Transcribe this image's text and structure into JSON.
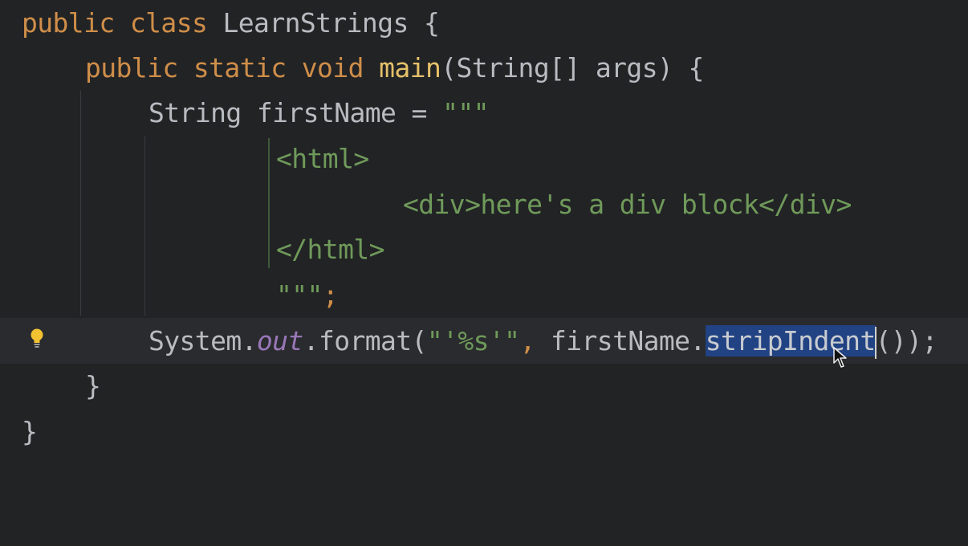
{
  "code": {
    "line1": {
      "kw1": "public",
      "kw2": "class",
      "name": "LearnStrings",
      "brace": "{"
    },
    "line2": {
      "kw1": "public",
      "kw2": "static",
      "kw3": "void",
      "fn": "main",
      "params": "(String[] args) {"
    },
    "line3": {
      "type": "String firstName = ",
      "quotes": "\"\"\""
    },
    "line4": {
      "text": "<html>"
    },
    "line5": {
      "text": "<div>here's a div block</div>"
    },
    "line6": {
      "text": "</html>"
    },
    "line7": {
      "quotes": "\"\"\"",
      "semi": ";"
    },
    "line8": {
      "obj": "System.",
      "field": "out",
      "call": ".format(",
      "str": "\"'%s'\"",
      "comma": ", ",
      "var": "firstName.",
      "selected": "stripIndent",
      "end": "());"
    },
    "line9": {
      "brace": "}"
    },
    "line10": {
      "brace": "}"
    }
  },
  "icons": {
    "gutter": "lightbulb-icon",
    "pointer": "mouse-cursor-icon"
  },
  "colors": {
    "background": "#222325",
    "current_line": "#2a2b2e",
    "keyword": "#cf8e49",
    "function": "#e6c16a",
    "string": "#6f9a5a",
    "field": "#9977b8",
    "text": "#b8bcc1",
    "selection": "#214283"
  }
}
